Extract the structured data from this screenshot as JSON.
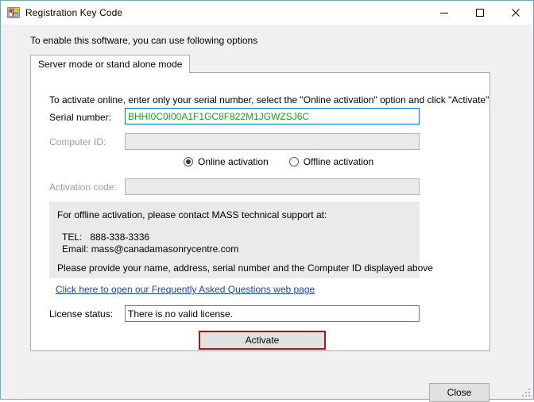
{
  "window": {
    "title": "Registration Key Code",
    "icon": "application-form-icon",
    "border_color": "#6daab3",
    "controls": {
      "minimize": "minimize-icon",
      "maximize": "maximize-icon",
      "close": "close-icon"
    }
  },
  "header": {
    "text": "To enable this software, you can use following options"
  },
  "tabs": [
    {
      "label": "Server mode or stand alone mode",
      "selected": true
    }
  ],
  "tabpage": {
    "intro": "To activate online, enter only your serial number, select the \"Online activation\" option and click \"Activate\"",
    "fields": {
      "serial": {
        "label": "Serial number:",
        "value": "BHHI0C0I00A1F1GC8F822M1JGWZSJ6C",
        "placeholder": "",
        "enabled": true,
        "focused": true,
        "text_color": "#17a317",
        "border_color": "#0078d7"
      },
      "computer_id": {
        "label": "Computer ID:",
        "value": "",
        "placeholder": "",
        "enabled": false
      },
      "activation_code": {
        "label": "Activation code:",
        "value": "",
        "placeholder": "",
        "enabled": false
      },
      "license_status": {
        "label": "License status:",
        "value": "There is no valid license.",
        "placeholder": "",
        "enabled": true
      }
    },
    "activation_mode": {
      "options": [
        {
          "label": "Online activation",
          "selected": true
        },
        {
          "label": "Offline activation",
          "selected": false
        }
      ]
    },
    "offline_panel": {
      "line1": "For offline activation, please contact MASS technical support at:",
      "tel_label": "TEL:",
      "tel_value": "888-338-3336",
      "email_label": "Email:",
      "email_value": "mass@canadamasonrycentre.com",
      "line4": "Please provide your name, address, serial number and the Computer ID displayed above",
      "background": "#eaeaea"
    },
    "faq_link": {
      "text": "Click here to open our Frequently Asked Questions web page",
      "color": "#1a3fd4"
    },
    "activate_button": {
      "label": "Activate",
      "border_color": "#b01515"
    }
  },
  "footer": {
    "close_button": "Close"
  }
}
